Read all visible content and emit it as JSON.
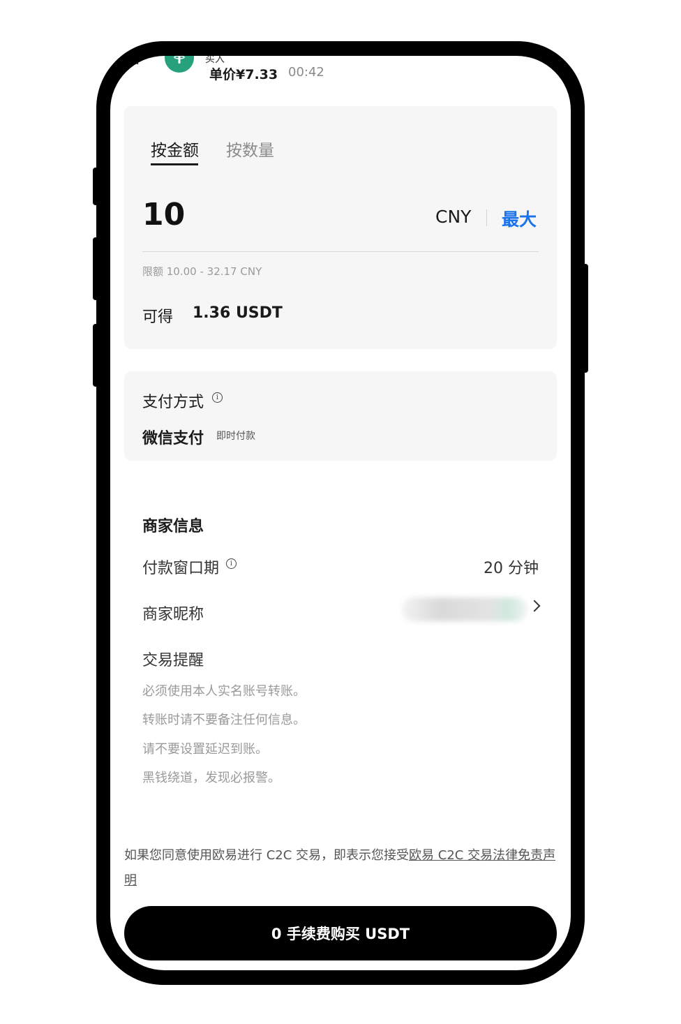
{
  "header": {
    "clipped_text": "买入",
    "unit_price": "单价¥7.33",
    "countdown": "00:42"
  },
  "amount_card": {
    "tabs": [
      {
        "label": "按金额",
        "active": true
      },
      {
        "label": "按数量",
        "active": false
      }
    ],
    "amount_value": "10",
    "currency": "CNY",
    "max_label": "最大",
    "limit_text": "限额 10.00 - 32.17 CNY",
    "receive_label": "可得",
    "receive_value": "1.36 USDT"
  },
  "payment": {
    "title": "支付方式",
    "info_icon": "i",
    "method": "微信支付",
    "method_badge": "即时付款"
  },
  "merchant": {
    "title": "商家信息",
    "payment_window_label": "付款窗口期",
    "payment_window_value": "20 分钟",
    "nickname_label": "商家昵称",
    "tips_title": "交易提醒",
    "tips": [
      "必须使用本人实名账号转账。",
      "转账时请不要备注任何信息。",
      "请不要设置延迟到账。",
      "黑钱绕道，发现必报警。"
    ]
  },
  "disclaimer": {
    "text": "如果您同意使用欧易进行 C2C 交易，即表示您接受",
    "link": "欧易 C2C 交易法律免责声明"
  },
  "buy_button": "0 手续费购买 USDT",
  "colors": {
    "accent_blue": "#1a73e8",
    "usdt_green": "#26a17b",
    "card_bg": "#f6f6f6",
    "button_bg": "#000000"
  }
}
